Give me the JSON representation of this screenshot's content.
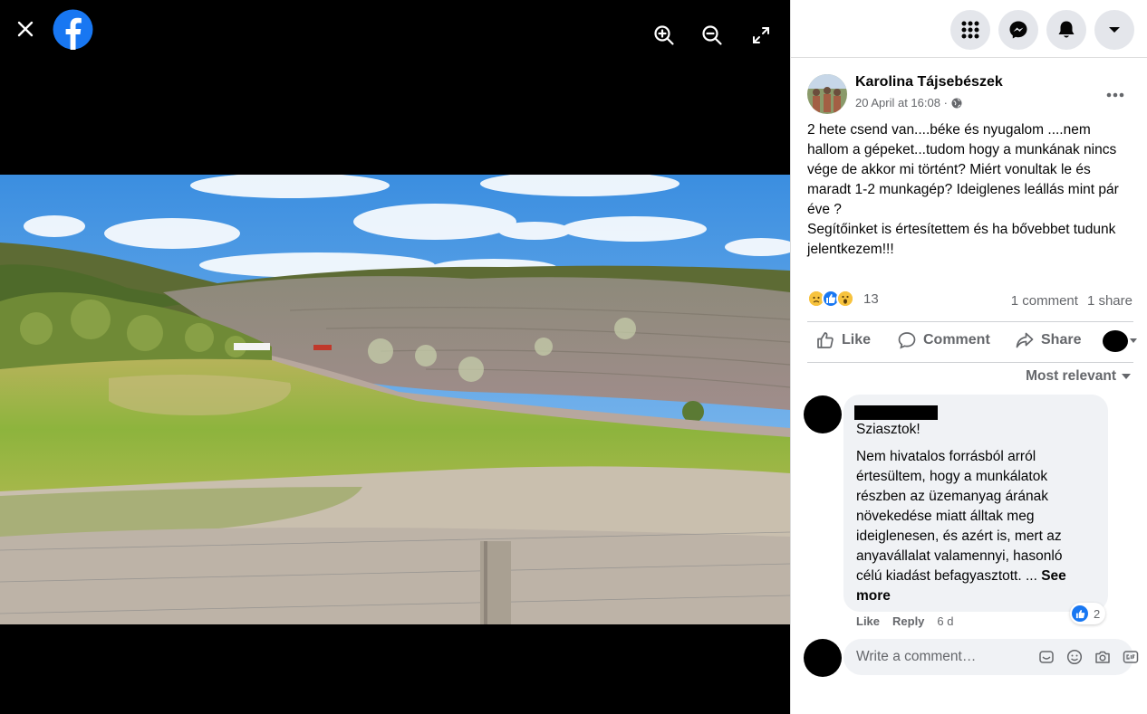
{
  "viewer": {
    "close_icon": "close-icon",
    "logo_icon": "facebook-logo",
    "zoom_in_icon": "zoom-in-icon",
    "zoom_out_icon": "zoom-out-icon",
    "fullscreen_icon": "fullscreen-icon",
    "photo_icon": "landscape-quarry-photo"
  },
  "topbar": {
    "menu_icon": "grid-menu-icon",
    "messenger_icon": "messenger-icon",
    "notifications_icon": "bell-icon",
    "account_icon": "caret-down-icon"
  },
  "post": {
    "author": "Karolina Tájsebészek",
    "timestamp": "20 April at 16:08 ·",
    "audience_icon": "globe-icon",
    "text_lines": [
      "2 hete csend van....béke és nyugalom ....nem hallom a gépeket...tudom hogy a munkának nincs vége de akkor mi történt? Miért vonultak le és maradt 1-2 munkagép? Ideiglenes leállás mint pár éve ?",
      "Segítőinket is értesítettem és ha bővebbet tudunk jelentkezem!!!"
    ],
    "reaction_count": "13",
    "comment_count": "1 comment",
    "share_count": "1 share"
  },
  "actions": {
    "like": "Like",
    "comment": "Comment",
    "share": "Share"
  },
  "comments": {
    "sort_label": "Most relevant",
    "items": [
      {
        "greeting": "Sziasztok!",
        "body": "Nem hivatalos forrásból arról értesültem, hogy a munkálatok részben az üzemanyag árának növekedése miatt álltak meg ideiglenesen, és azért is, mert az anyavállalat valamennyi, hasonló célú kiadást befagyasztott. ...",
        "see_more": "See more",
        "like_label": "Like",
        "reply_label": "Reply",
        "age": "6 d",
        "reactions": "2"
      }
    ],
    "write_placeholder": "Write a comment…"
  },
  "colors": {
    "fb_blue": "#1877f2",
    "panel_bg": "#ffffff",
    "bubble_bg": "#f0f2f5",
    "muted_text": "#65676b"
  }
}
